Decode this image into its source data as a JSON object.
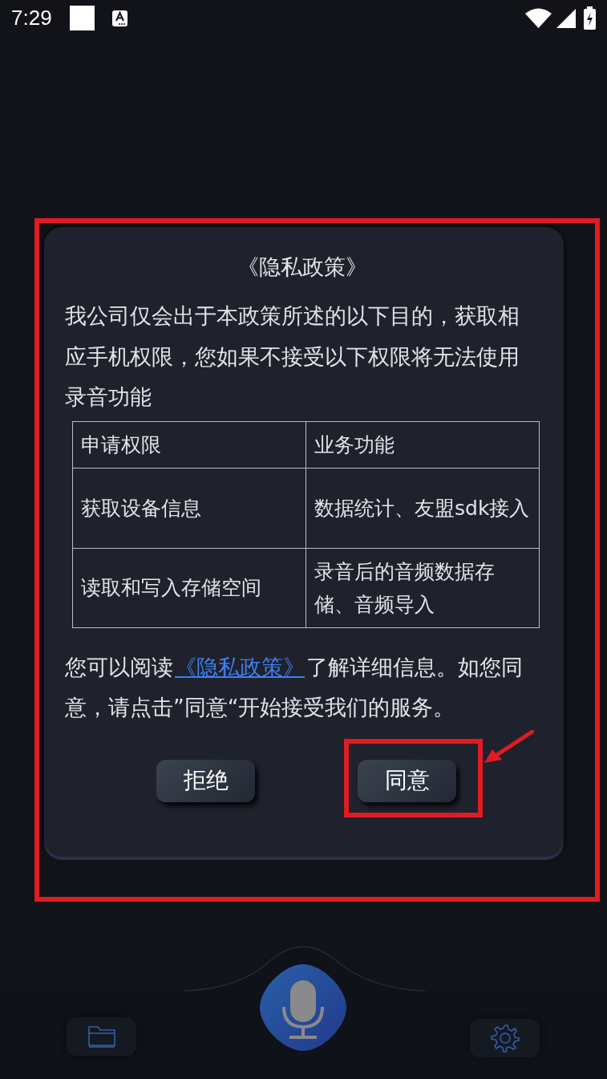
{
  "status_bar": {
    "time": "7:29"
  },
  "dialog": {
    "title": "《隐私政策》",
    "intro": "我公司仅会出于本政策所述的以下目的，获取相应手机权限，您如果不接受以下权限将无法使用录音功能",
    "table": {
      "columns": [
        "申请权限",
        "业务功能"
      ],
      "rows": [
        [
          "获取设备信息",
          "数据统计、友盟sdk接入"
        ],
        [
          "读取和写入存储空间",
          "录音后的音频数据存储、音频导入"
        ]
      ]
    },
    "notice": {
      "before": "您可以阅读",
      "link": "《隐私政策》",
      "after": "了解详细信息。如您同意，请点击”同意“开始接受我们的服务。"
    },
    "buttons": [
      {
        "label": "拒绝",
        "highlighted": false
      },
      {
        "label": "同意",
        "highlighted": true
      }
    ]
  }
}
